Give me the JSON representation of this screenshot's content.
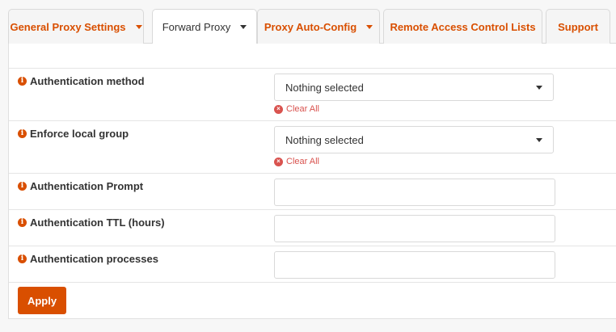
{
  "tabs": [
    {
      "label": "General Proxy Settings",
      "dropdown": true,
      "active": false
    },
    {
      "label": "Forward Proxy",
      "dropdown": true,
      "active": true
    },
    {
      "label": "Proxy Auto-Config",
      "dropdown": true,
      "active": false
    },
    {
      "label": "Remote Access Control Lists",
      "dropdown": false,
      "active": false
    },
    {
      "label": "Support",
      "dropdown": false,
      "active": false
    }
  ],
  "form": {
    "auth_method": {
      "label": "Authentication method",
      "value": "Nothing selected",
      "clear": "Clear All"
    },
    "local_group": {
      "label": "Enforce local group",
      "value": "Nothing selected",
      "clear": "Clear All"
    },
    "auth_prompt": {
      "label": "Authentication Prompt",
      "value": ""
    },
    "auth_ttl": {
      "label": "Authentication TTL (hours)",
      "value": ""
    },
    "auth_processes": {
      "label": "Authentication processes",
      "value": ""
    }
  },
  "apply_label": "Apply",
  "colors": {
    "accent": "#d94f00",
    "danger": "#d9534f"
  },
  "icons": {
    "info": "info-circle-icon",
    "clear": "times-circle-icon",
    "caret": "caret-down-icon"
  }
}
